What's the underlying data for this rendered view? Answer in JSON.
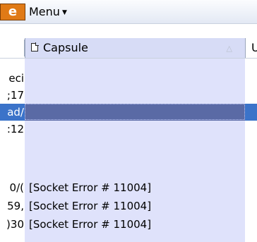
{
  "menubar": {
    "app_icon_text": "e",
    "menu_label": "Menu",
    "menu_caret": "▼"
  },
  "columns": {
    "capsule": "Capsule",
    "next_partial": "U",
    "sort_glyph": "△"
  },
  "rows": [
    {
      "c0": "eci",
      "c1": ""
    },
    {
      "c0": ";17",
      "c1": ""
    },
    {
      "c0": "ad/",
      "c1": "",
      "selected": true
    },
    {
      "c0": ":12",
      "c1": ""
    },
    {
      "c0": "",
      "c1": ""
    },
    {
      "c0": "0/(",
      "c1": "[Socket Error # 11004]"
    },
    {
      "c0": "59,",
      "c1": "[Socket Error # 11004]"
    },
    {
      "c0": ")30",
      "c1": "[Socket Error # 11004]"
    }
  ]
}
